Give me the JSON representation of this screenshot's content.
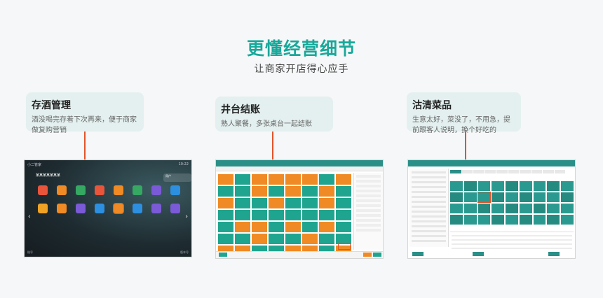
{
  "hero": {
    "title": "更懂经营细节",
    "subtitle": "让商家开店得心应手"
  },
  "features": [
    {
      "title": "存酒管理",
      "desc": "酒没喝完存着下次再来，便于商家做复购营销"
    },
    {
      "title": "井台结账",
      "desc": "熟人聚餐，多张桌台一起结账"
    },
    {
      "title": "沽清菜品",
      "desc": "生意太好，菜没了，不用急，提前跟客人说明，换个好吃的"
    }
  ],
  "colors": {
    "accent": "#18a89a",
    "highlight": "#e1542a",
    "card_bg": "#e3f0ef"
  },
  "screen1": {
    "top_left": "小二管家",
    "top_right": "10:22",
    "header": "某某某某某某某",
    "account": "用户",
    "bottom_left": "账号",
    "bottom_right": "版本号"
  }
}
